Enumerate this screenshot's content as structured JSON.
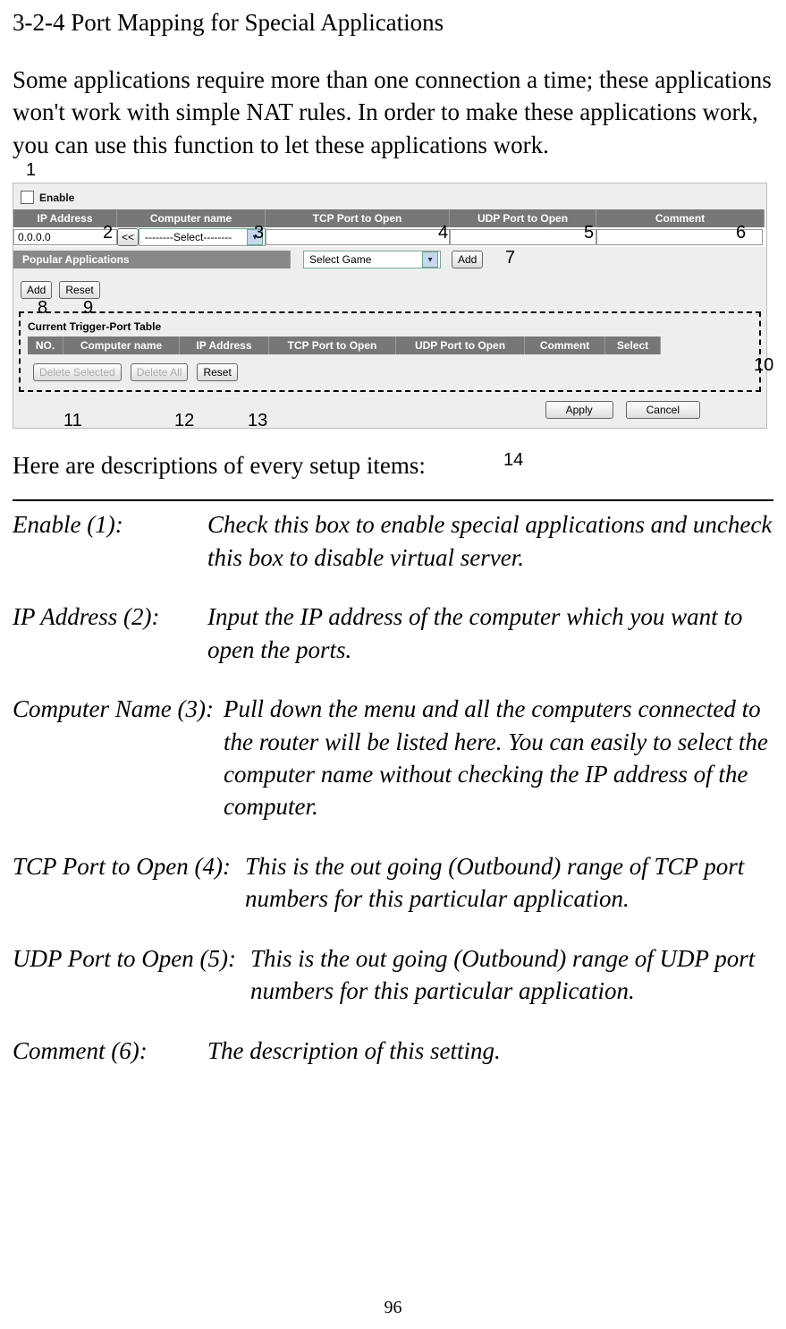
{
  "title": "3-2-4 Port Mapping for Special Applications",
  "intro": "Some applications require more than one connection a time; these applications won't work with simple NAT rules. In order to make these applications work, you can use this function to let these applications work.",
  "screenshot": {
    "enable_label": "Enable",
    "headers": {
      "ip": "IP Address",
      "cname": "Computer name",
      "tcp": "TCP Port to Open",
      "udp": "UDP Port to Open",
      "comment": "Comment"
    },
    "ip_value": "0.0.0.0",
    "copy_btn": "<<",
    "cname_select": "--------Select--------",
    "popular_label": "Popular Applications",
    "game_select": "Select Game",
    "add_game_btn": "Add",
    "add_btn": "Add",
    "reset_btn": "Reset",
    "table_title": "Current Trigger-Port Table",
    "thdr": {
      "no": "NO.",
      "cname": "Computer name",
      "ip": "IP Address",
      "tcp": "TCP Port to Open",
      "udp": "UDP Port to Open",
      "comment": "Comment",
      "select": "Select"
    },
    "del_sel": "Delete Selected",
    "del_all": "Delete All",
    "reset2": "Reset",
    "apply": "Apply",
    "cancel": "Cancel"
  },
  "ann": {
    "n1": "1",
    "n2": "2",
    "n3": "3",
    "n4": "4",
    "n5": "5",
    "n6": "6",
    "n7": "7",
    "n8": "8",
    "n9": "9",
    "n10": "10",
    "n11": "11",
    "n12": "12",
    "n13": "13",
    "n14": "14"
  },
  "desc_intro": "Here are descriptions of every setup items:",
  "descriptions": {
    "d1k": "Enable (1):",
    "d1v": "Check this box to enable special applications and uncheck this box to disable virtual server.",
    "d2k": "IP Address (2):",
    "d2v": "Input the IP address of the computer which you want to open the ports.",
    "d3k": "Computer Name (3):",
    "d3v": "Pull down the menu and all the computers connected to the router will be listed here. You can easily to select the computer name without checking the IP address of the computer.",
    "d4k": "TCP Port to Open (4):",
    "d4v": "This is the out going (Outbound) range of TCP port numbers for this particular application.",
    "d5k": "UDP Port to Open (5):",
    "d5v": "This is the out going (Outbound) range of UDP port numbers for this particular application.",
    "d6k": "Comment (6):",
    "d6v": "The description of this setting."
  },
  "page_number": "96"
}
